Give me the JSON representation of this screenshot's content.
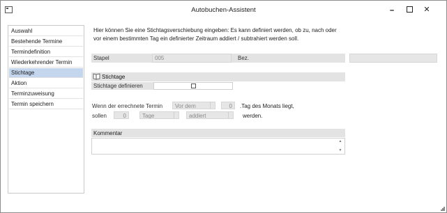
{
  "window": {
    "title": "Autobuchen-Assistent",
    "minimize_glyph": "🗕",
    "close_glyph": "✕"
  },
  "sidebar": {
    "items": [
      {
        "label": "Auswahl",
        "active": false
      },
      {
        "label": "Bestehende Termine",
        "active": false
      },
      {
        "label": "Termindefinition",
        "active": false
      },
      {
        "label": "Wiederkehrender Termin",
        "active": false
      },
      {
        "label": "Stichtage",
        "active": true
      },
      {
        "label": "Aktion",
        "active": false
      },
      {
        "label": "Terminzuweisung",
        "active": false
      },
      {
        "label": "Termin speichern",
        "active": false
      }
    ]
  },
  "main": {
    "intro_text": "Hier können Sie eine Stichtagsverschiebung eingeben: Es kann definiert werden, ob zu, nach oder vor einem bestimmten Tag ein definierter Zeitraum addiert / subtrahiert werden soll.",
    "stapel": {
      "label": "Stapel",
      "value": "005"
    },
    "bez": {
      "label": "Bez.",
      "value": ""
    },
    "section_title": "Stichtage",
    "stichtage_definieren": {
      "label": "Stichtage definieren",
      "checked": false
    },
    "rule": {
      "line1_prefix": "Wenn der errechnete Termin",
      "position_value": "Vor dem",
      "day_value": "0",
      "line1_suffix": ".Tag des Monats liegt,",
      "line2_prefix": "sollen",
      "amount_value": "0",
      "unit_value": "Tage",
      "operation_value": "addiert",
      "line2_suffix": "werden."
    },
    "kommentar": {
      "label": "Kommentar",
      "value": ""
    }
  }
}
